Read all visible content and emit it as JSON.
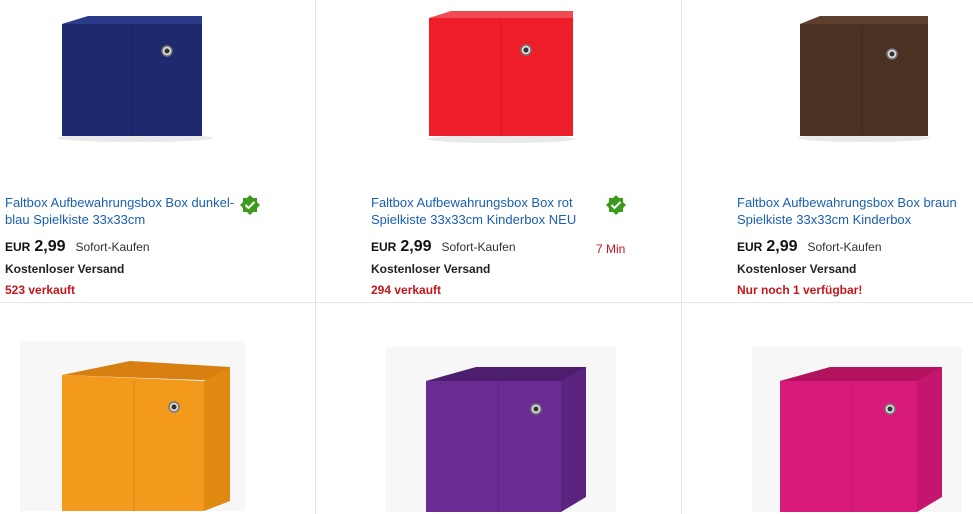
{
  "listings": [
    {
      "title": "Faltbox Aufbewahrungsbox Box dunkel-blau Spielkiste 33x33cm",
      "currency": "EUR",
      "price": "2,99",
      "buy_type": "Sofort-Kaufen",
      "shipping": "Kostenloser Versand",
      "sold": "523 verkauft",
      "badge": "top-seller-icon",
      "box_color": "#1e2a6e"
    },
    {
      "title": "Faltbox Aufbewahrungsbox Box rot Spielkiste 33x33cm Kinderbox NEU",
      "currency": "EUR",
      "price": "2,99",
      "buy_type": "Sofort-Kaufen",
      "time_left": "7 Min",
      "shipping": "Kostenloser Versand",
      "sold": "294 verkauft",
      "badge": "top-seller-icon",
      "box_color": "#ee1d2a"
    },
    {
      "title": "Faltbox Aufbewahrungsbox Box braun Spielkiste 33x33cm Kinderbox",
      "currency": "EUR",
      "price": "2,99",
      "buy_type": "Sofort-Kaufen",
      "shipping": "Kostenloser Versand",
      "sold": "Nur noch 1 verfügbar!",
      "box_color": "#4a3122"
    },
    {
      "box_color": "#f39a1d"
    },
    {
      "box_color": "#6a2b92"
    },
    {
      "box_color": "#d81a7a"
    }
  ],
  "colors": {
    "link": "#1a5fb4",
    "alert": "#c4161c",
    "badge": "#3c9a1d"
  }
}
